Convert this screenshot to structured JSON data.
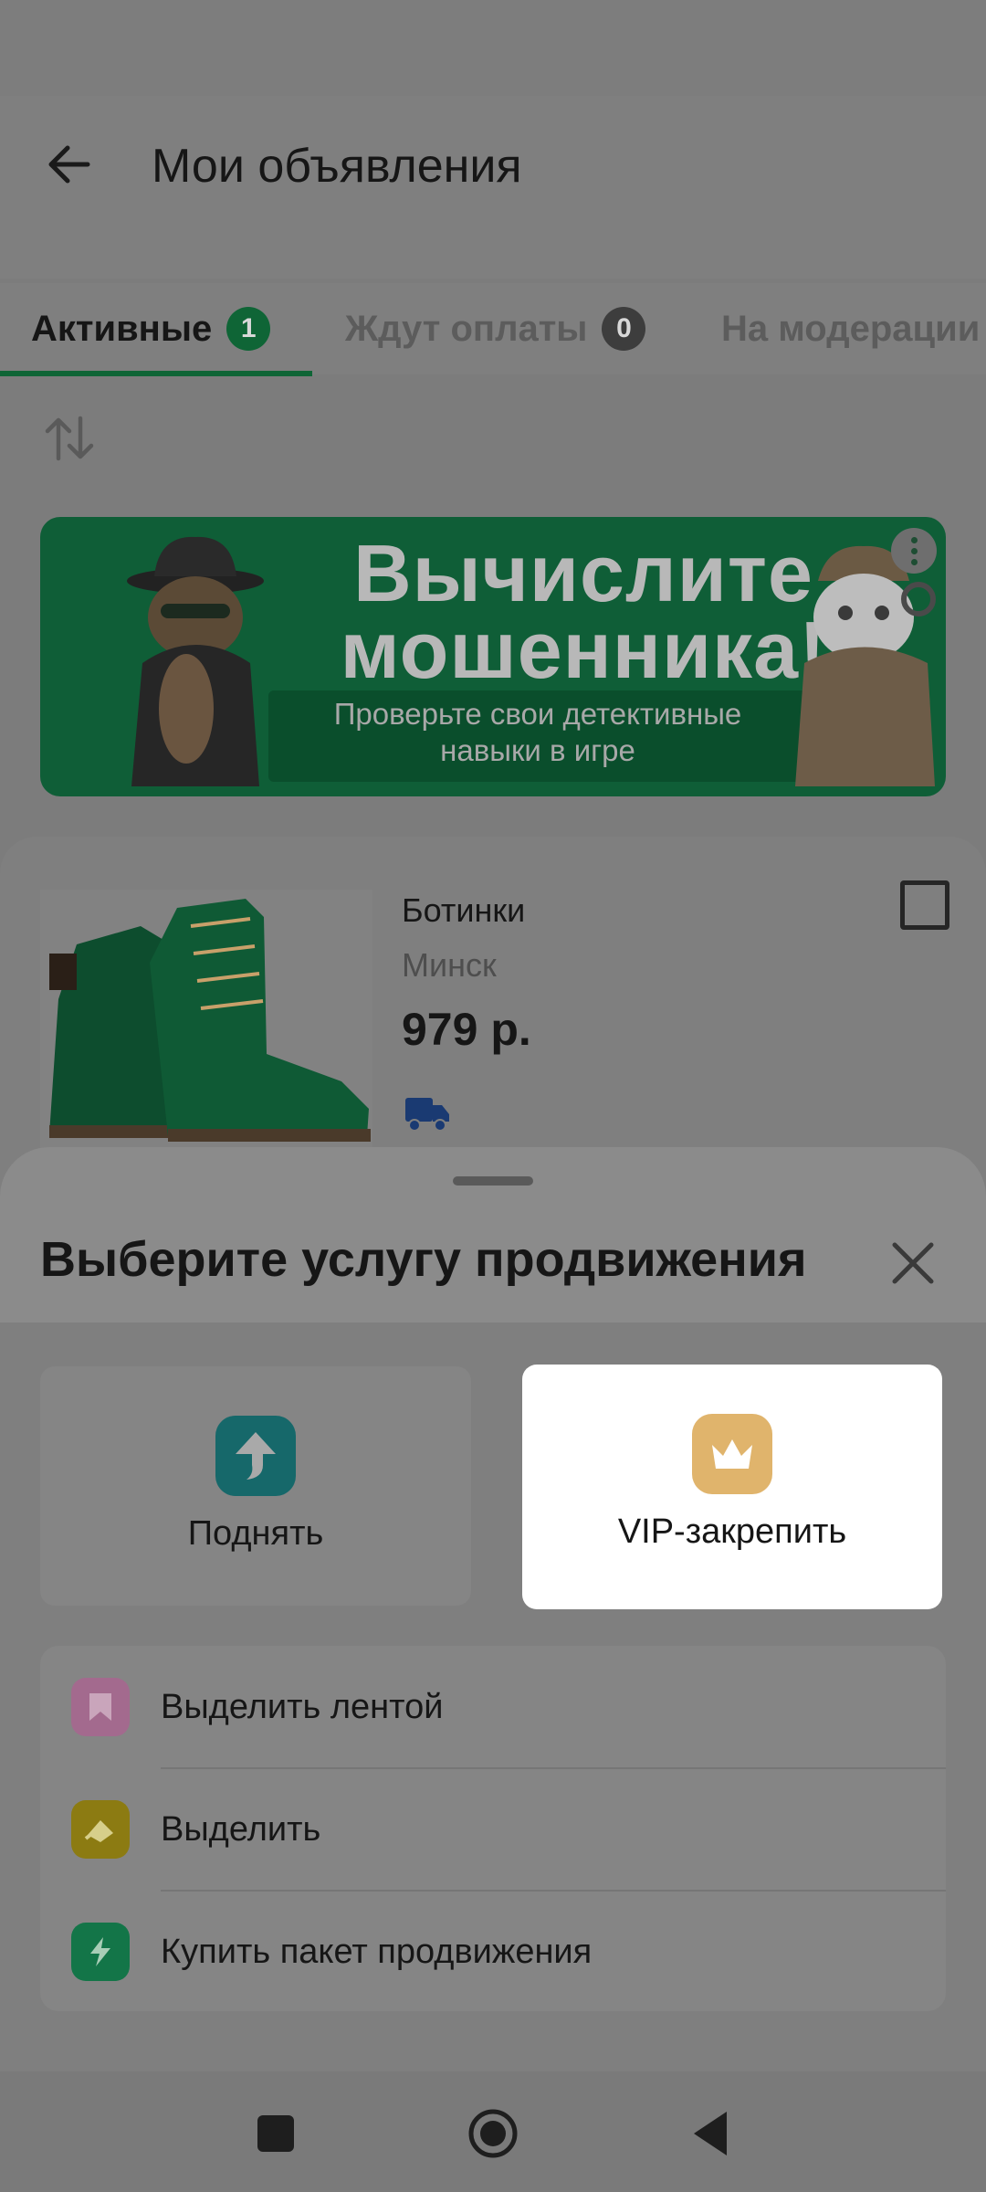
{
  "header": {
    "title": "Мои объявления"
  },
  "tabs": [
    {
      "label": "Активные",
      "count": "1"
    },
    {
      "label": "Ждут оплаты",
      "count": "0"
    },
    {
      "label": "На модерации"
    }
  ],
  "banner": {
    "title_line1": "Вычислите",
    "title_line2": "мошенника!",
    "subtitle_line1": "Проверьте свои детективные",
    "subtitle_line2": "навыки в игре"
  },
  "listing": {
    "title": "Ботинки",
    "city": "Минск",
    "price": "979 р."
  },
  "sheet": {
    "title": "Выберите услугу продвижения",
    "options": [
      {
        "label": "Поднять",
        "icon": "arrow-up-icon",
        "color": "#16686a"
      },
      {
        "label": "VIP-закрепить",
        "icon": "crown-icon",
        "color": "#e0b46c"
      }
    ],
    "list": [
      {
        "label": "Выделить лентой",
        "icon": "bookmark-icon",
        "color": "#a36a8e"
      },
      {
        "label": "Выделить",
        "icon": "paint-bucket-icon",
        "color": "#8c7b12"
      },
      {
        "label": "Купить пакет продвижения",
        "icon": "lightning-icon",
        "color": "#137548"
      }
    ]
  },
  "colors": {
    "brand_green": "#0f6536",
    "scrim": "#7f7f7f",
    "selected_card": "#ffffff"
  }
}
